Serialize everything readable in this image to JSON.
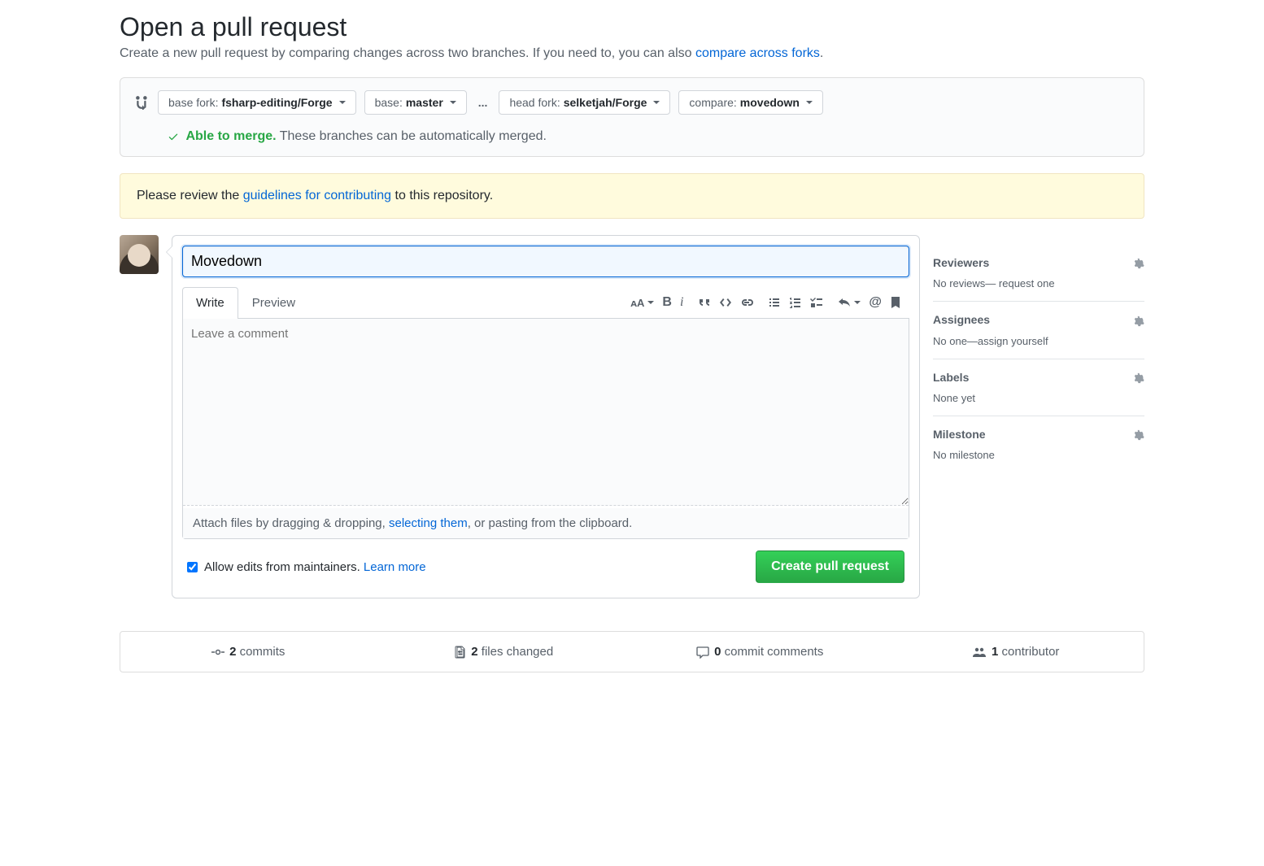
{
  "heading": "Open a pull request",
  "subtitle_prefix": "Create a new pull request by comparing changes across two branches. If you need to, you can also ",
  "subtitle_link": "compare across forks",
  "subtitle_suffix": ".",
  "branch": {
    "base_fork_label": "base fork: ",
    "base_fork_value": "fsharp-editing/Forge",
    "base_label": "base: ",
    "base_value": "master",
    "head_fork_label": "head fork: ",
    "head_fork_value": "selketjah/Forge",
    "compare_label": "compare: ",
    "compare_value": "movedown"
  },
  "merge": {
    "status_text": "Able to merge.",
    "detail": " These branches can be automatically merged."
  },
  "notice": {
    "prefix": "Please review the ",
    "link": "guidelines for contributing",
    "suffix": " to this repository."
  },
  "form": {
    "title_value": "Movedown",
    "tab_write": "Write",
    "tab_preview": "Preview",
    "comment_placeholder": "Leave a comment",
    "attach_prefix": "Attach files by dragging & dropping, ",
    "attach_link": "selecting them",
    "attach_suffix": ", or pasting from the clipboard.",
    "allow_edits": "Allow edits from maintainers. ",
    "learn_more": "Learn more",
    "submit": "Create pull request"
  },
  "sidebar": {
    "reviewers_title": "Reviewers",
    "reviewers_body": "No reviews— request one",
    "assignees_title": "Assignees",
    "assignees_body_prefix": "No one—",
    "assignees_body_link": "assign yourself",
    "labels_title": "Labels",
    "labels_body": "None yet",
    "milestone_title": "Milestone",
    "milestone_body": "No milestone"
  },
  "stats": {
    "commits_count": "2",
    "commits_label": " commits",
    "files_count": "2",
    "files_label": " files changed",
    "comments_count": "0",
    "comments_label": " commit comments",
    "contributors_count": "1",
    "contributors_label": " contributor"
  }
}
